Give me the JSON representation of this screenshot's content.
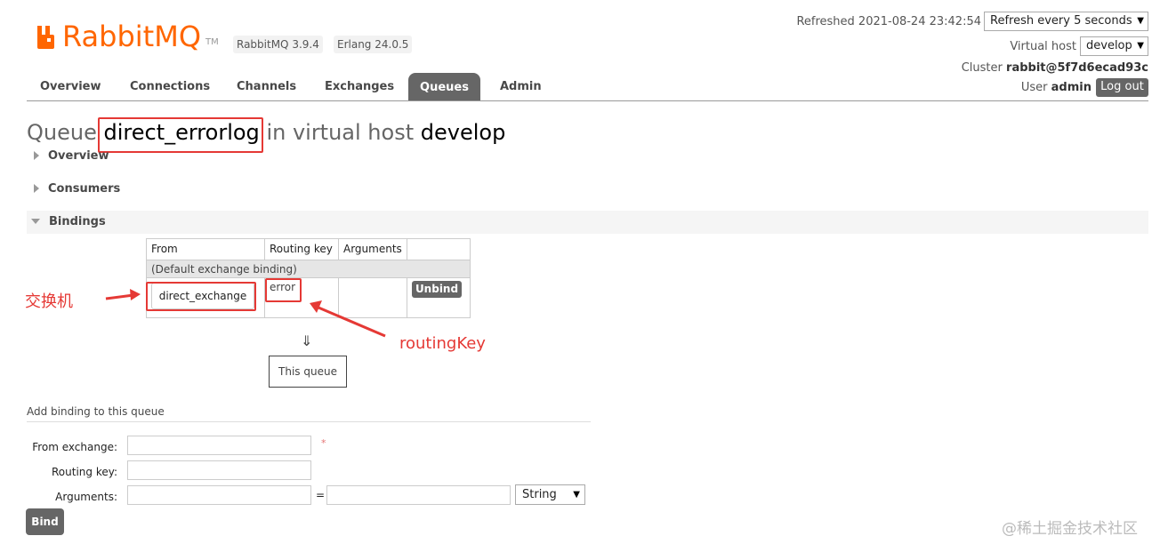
{
  "brand": {
    "logo_text": "RabbitMQ",
    "tm": "TM",
    "rabbitmq_version": "RabbitMQ 3.9.4",
    "erlang_version": "Erlang 24.0.5",
    "color": "#ff6600"
  },
  "header": {
    "refreshed_label": "Refreshed 2021-08-24 23:42:54",
    "refresh_select": "Refresh every 5 seconds",
    "virtual_host_label": "Virtual host",
    "virtual_host_value": "develop",
    "cluster_label": "Cluster",
    "cluster_value": "rabbit@5f7d6ecad93c",
    "user_label": "User",
    "user_value": "admin",
    "logout_label": "Log out"
  },
  "tabs": [
    {
      "label": "Overview"
    },
    {
      "label": "Connections"
    },
    {
      "label": "Channels"
    },
    {
      "label": "Exchanges"
    },
    {
      "label": "Queues",
      "active": true
    },
    {
      "label": "Admin"
    }
  ],
  "title": {
    "prefix": "Queue",
    "queue_name": "direct_errorlog",
    "middle": "in virtual host",
    "vhost": "develop"
  },
  "sections": {
    "overview": "Overview",
    "consumers": "Consumers",
    "bindings": "Bindings"
  },
  "bindings_table": {
    "headers": [
      "From",
      "Routing key",
      "Arguments",
      ""
    ],
    "default_row": "(Default exchange binding)",
    "row": {
      "from": "direct_exchange",
      "routing_key": "error",
      "arguments": "",
      "unbind_label": "Unbind"
    },
    "down_arrow": "⇓",
    "this_queue": "This queue"
  },
  "annotations": {
    "exchange_label": "交换机",
    "routing_key_label": "routingKey",
    "color": "#e53935"
  },
  "add_binding": {
    "title": "Add binding to this queue",
    "from_exchange_label": "From exchange:",
    "required_mark": "*",
    "routing_key_label": "Routing key:",
    "arguments_label": "Arguments:",
    "equals": "=",
    "type_select": "String",
    "bind_label": "Bind"
  },
  "watermark": "@稀土掘金技术社区"
}
